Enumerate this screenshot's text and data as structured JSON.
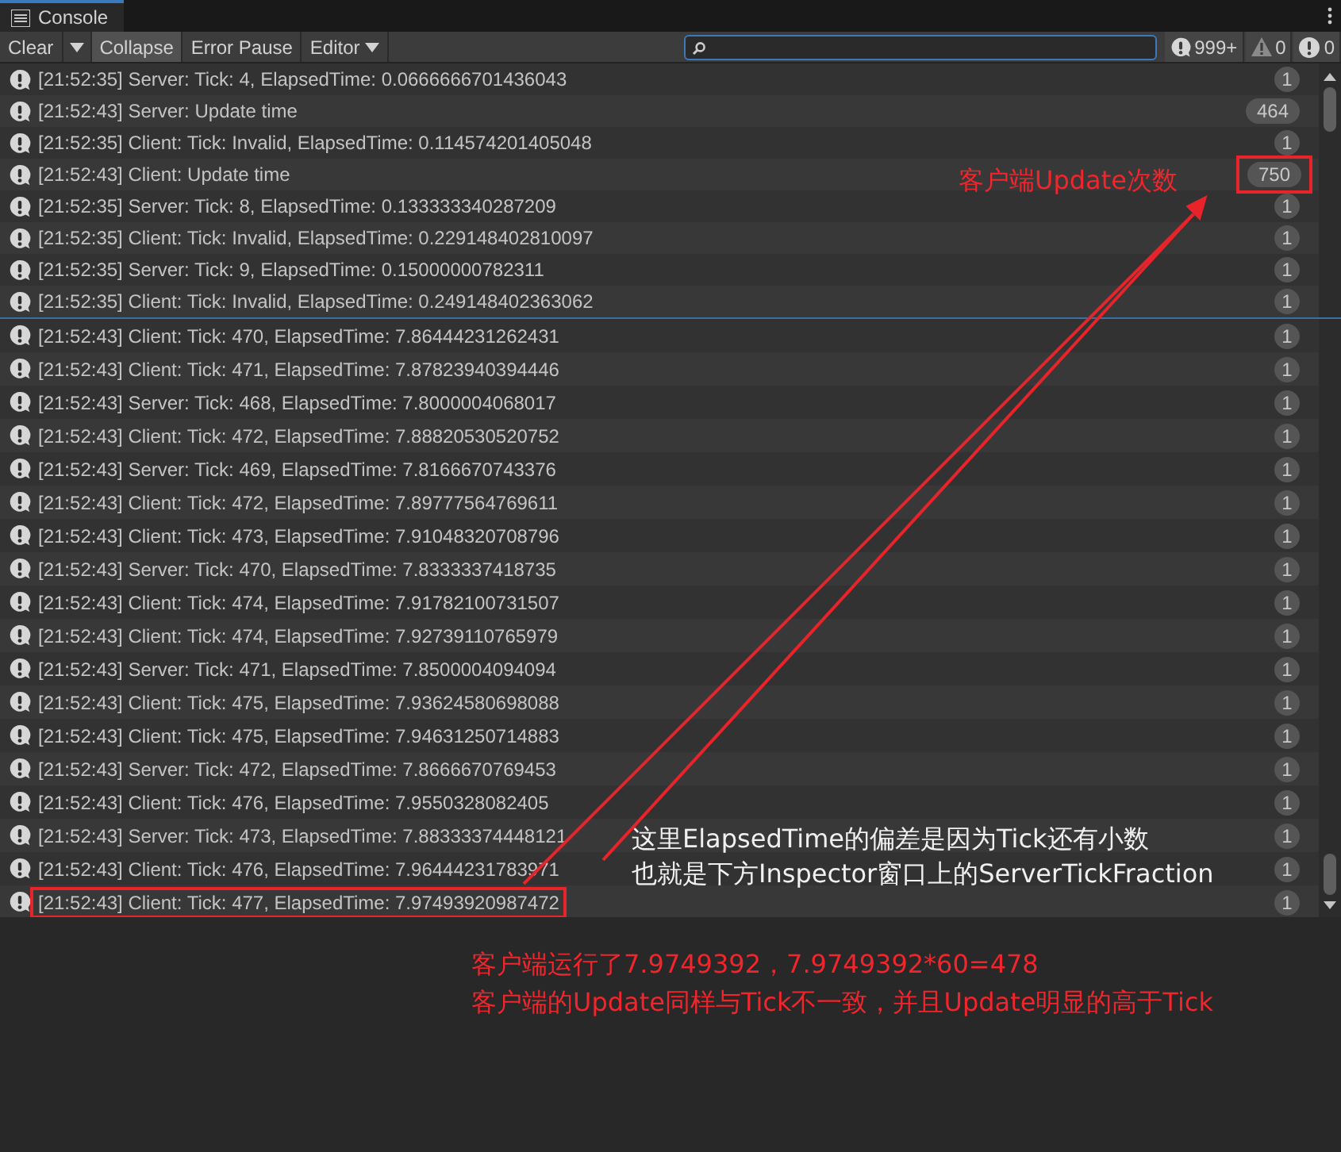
{
  "window": {
    "title": "Console"
  },
  "toolbar": [
    {
      "label": "Clear",
      "kind": "split"
    },
    {
      "label": "Collapse",
      "kind": "toggle",
      "selected": true
    },
    {
      "label": "Error Pause",
      "kind": "toggle",
      "selected": false
    },
    {
      "label": "Editor",
      "kind": "dropdown"
    }
  ],
  "search": {
    "focused": true
  },
  "counters": [
    {
      "kind": "info",
      "count": "999+"
    },
    {
      "kind": "warning",
      "count": "0"
    },
    {
      "kind": "error",
      "count": "0"
    }
  ],
  "logs_top": [
    {
      "text": "[21:52:35] Server: Tick: 4, ElapsedTime: 0.0666666701436043",
      "count": "1",
      "count_highlighted": false,
      "message_highlighted": false
    },
    {
      "text": "[21:52:43] Server: Update time",
      "count": "464",
      "count_highlighted": false,
      "message_highlighted": false
    },
    {
      "text": "[21:52:35] Client: Tick: Invalid, ElapsedTime: 0.114574201405048",
      "count": "1",
      "count_highlighted": false,
      "message_highlighted": false
    },
    {
      "text": "[21:52:43] Client: Update time",
      "count": "750",
      "count_highlighted": true,
      "message_highlighted": false
    },
    {
      "text": "[21:52:35] Server: Tick: 8, ElapsedTime: 0.133333340287209",
      "count": "1",
      "count_highlighted": false,
      "message_highlighted": false
    },
    {
      "text": "[21:52:35] Client: Tick: Invalid, ElapsedTime: 0.229148402810097",
      "count": "1",
      "count_highlighted": false,
      "message_highlighted": false
    },
    {
      "text": "[21:52:35] Server: Tick: 9, ElapsedTime: 0.15000000782311",
      "count": "1",
      "count_highlighted": false,
      "message_highlighted": false
    },
    {
      "text": "[21:52:35] Client: Tick: Invalid, ElapsedTime: 0.249148402363062",
      "count": "1",
      "count_highlighted": false,
      "message_highlighted": false
    }
  ],
  "logs_bottom": [
    {
      "text": "[21:52:43] Client: Tick: 470, ElapsedTime: 7.86444231262431",
      "count": "1",
      "count_highlighted": false,
      "message_highlighted": false
    },
    {
      "text": "[21:52:43] Client: Tick: 471, ElapsedTime: 7.87823940394446",
      "count": "1",
      "count_highlighted": false,
      "message_highlighted": false
    },
    {
      "text": "[21:52:43] Server: Tick: 468, ElapsedTime: 7.8000004068017",
      "count": "1",
      "count_highlighted": false,
      "message_highlighted": false
    },
    {
      "text": "[21:52:43] Client: Tick: 472, ElapsedTime: 7.88820530520752",
      "count": "1",
      "count_highlighted": false,
      "message_highlighted": false
    },
    {
      "text": "[21:52:43] Server: Tick: 469, ElapsedTime: 7.8166670743376",
      "count": "1",
      "count_highlighted": false,
      "message_highlighted": false
    },
    {
      "text": "[21:52:43] Client: Tick: 472, ElapsedTime: 7.89777564769611",
      "count": "1",
      "count_highlighted": false,
      "message_highlighted": false
    },
    {
      "text": "[21:52:43] Client: Tick: 473, ElapsedTime: 7.91048320708796",
      "count": "1",
      "count_highlighted": false,
      "message_highlighted": false
    },
    {
      "text": "[21:52:43] Server: Tick: 470, ElapsedTime: 7.8333337418735",
      "count": "1",
      "count_highlighted": false,
      "message_highlighted": false
    },
    {
      "text": "[21:52:43] Client: Tick: 474, ElapsedTime: 7.91782100731507",
      "count": "1",
      "count_highlighted": false,
      "message_highlighted": false
    },
    {
      "text": "[21:52:43] Client: Tick: 474, ElapsedTime: 7.92739110765979",
      "count": "1",
      "count_highlighted": false,
      "message_highlighted": false
    },
    {
      "text": "[21:52:43] Server: Tick: 471, ElapsedTime: 7.8500004094094",
      "count": "1",
      "count_highlighted": false,
      "message_highlighted": false
    },
    {
      "text": "[21:52:43] Client: Tick: 475, ElapsedTime: 7.93624580698088",
      "count": "1",
      "count_highlighted": false,
      "message_highlighted": false
    },
    {
      "text": "[21:52:43] Client: Tick: 475, ElapsedTime: 7.94631250714883",
      "count": "1",
      "count_highlighted": false,
      "message_highlighted": false
    },
    {
      "text": "[21:52:43] Server: Tick: 472, ElapsedTime: 7.8666670769453",
      "count": "1",
      "count_highlighted": false,
      "message_highlighted": false
    },
    {
      "text": "[21:52:43] Client: Tick: 476, ElapsedTime: 7.9550328082405",
      "count": "1",
      "count_highlighted": false,
      "message_highlighted": false
    },
    {
      "text": "[21:52:43] Server: Tick: 473, ElapsedTime: 7.88333374448121",
      "count": "1",
      "count_highlighted": false,
      "message_highlighted": false
    },
    {
      "text": "[21:52:43] Client: Tick: 476, ElapsedTime: 7.96444231783971",
      "count": "1",
      "count_highlighted": false,
      "message_highlighted": false
    },
    {
      "text": "[21:52:43] Client: Tick: 477, ElapsedTime: 7.97493920987472",
      "count": "1",
      "count_highlighted": false,
      "message_highlighted": true
    }
  ],
  "annotations": [
    {
      "kind": "red",
      "text": "客户端Update次数"
    },
    {
      "kind": "white",
      "text": "这里ElapsedTime的偏差是因为Tick还有小数"
    },
    {
      "kind": "white",
      "text": "也就是下方Inspector窗口上的ServerTickFraction"
    },
    {
      "kind": "red",
      "text": "客户端运行了7.9749392，7.9749392*60=478"
    },
    {
      "kind": "red",
      "text": "客户端的Update同样与Tick不一致，并且Update明显的高于Tick"
    }
  ]
}
